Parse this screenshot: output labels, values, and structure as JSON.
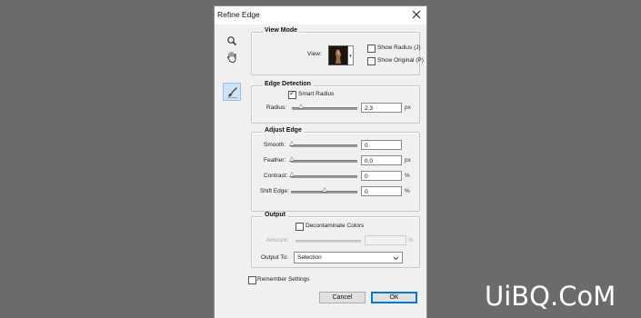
{
  "dialog": {
    "title": "Refine Edge"
  },
  "tools": [
    {
      "name": "zoom-tool-icon"
    },
    {
      "name": "hand-tool-icon"
    },
    {
      "name": "refine-radius-brush-icon"
    }
  ],
  "view_mode": {
    "title": "View Mode",
    "view_label": "View:",
    "show_radius_label": "Show Radius (J)",
    "show_radius_checked": false,
    "show_original_label": "Show Original (P)",
    "show_original_checked": false
  },
  "edge_detection": {
    "title": "Edge Detection",
    "smart_radius_label": "Smart Radius",
    "smart_radius_checked": true,
    "radius_label": "Radius:",
    "radius_value": "2.3",
    "radius_unit": "px",
    "radius_slider_fraction": 0.14
  },
  "adjust_edge": {
    "title": "Adjust Edge",
    "smooth_label": "Smooth:",
    "smooth_value": "0",
    "smooth_slider_fraction": 0.0,
    "feather_label": "Feather:",
    "feather_value": "0.0",
    "feather_unit": "px",
    "feather_slider_fraction": 0.0,
    "contrast_label": "Contrast:",
    "contrast_value": "0",
    "contrast_unit": "%",
    "contrast_slider_fraction": 0.0,
    "shift_edge_label": "Shift Edge:",
    "shift_edge_value": "0",
    "shift_edge_unit": "%",
    "shift_edge_slider_fraction": 0.5
  },
  "output": {
    "title": "Output",
    "decontaminate_label": "Decontaminate Colors",
    "decontaminate_checked": false,
    "amount_label": "Amount:",
    "amount_value": "",
    "amount_unit": "%",
    "output_to_label": "Output To:",
    "output_to_value": "Selection"
  },
  "remember_settings": {
    "label": "Remember Settings",
    "checked": false
  },
  "buttons": {
    "cancel": "Cancel",
    "ok": "OK"
  },
  "watermark": {
    "text": "UiBQ.CoM"
  },
  "colors": {
    "background": "#6b6b6d",
    "dialog": "#f0f0f0",
    "ok_border": "#0078d7",
    "active_tool": "#cfe3f5"
  }
}
